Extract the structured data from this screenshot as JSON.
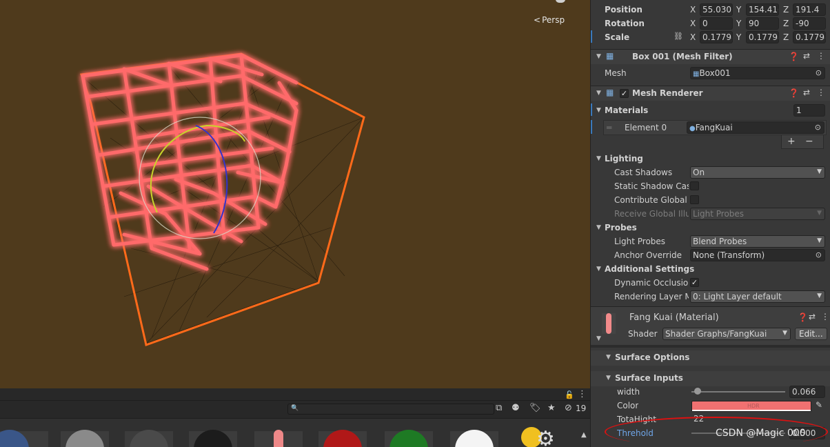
{
  "scene": {
    "camera_label": "Persp"
  },
  "project_bar": {
    "search_placeholder": "",
    "hidden_count": "19"
  },
  "inspector": {
    "transform": {
      "position_label": "Position",
      "rotation_label": "Rotation",
      "scale_label": "Scale",
      "position": {
        "x": "55.030",
        "y": "154.416",
        "z": "191.4"
      },
      "rotation": {
        "x": "0",
        "y": "90",
        "z": "-90"
      },
      "scale": {
        "x": "0.17798",
        "y": "0.17798",
        "z": "0.17798"
      }
    },
    "mesh_filter": {
      "title": "Box 001 (Mesh Filter)",
      "mesh_label": "Mesh",
      "mesh_value": "Box001"
    },
    "mesh_renderer": {
      "title": "Mesh Renderer",
      "materials_label": "Materials",
      "materials_count": "1",
      "element0_label": "Element 0",
      "element0_value": "FangKuai",
      "lighting_label": "Lighting",
      "cast_shadows_label": "Cast Shadows",
      "cast_shadows_value": "On",
      "static_shadow_label": "Static Shadow Cas",
      "contribute_gi_label": "Contribute Global Il",
      "receive_gi_label": "Receive Global Illu",
      "receive_gi_value": "Light Probes",
      "probes_label": "Probes",
      "light_probes_label": "Light Probes",
      "light_probes_value": "Blend Probes",
      "anchor_override_label": "Anchor Override",
      "anchor_override_value": "None (Transform)",
      "additional_settings_label": "Additional Settings",
      "dynamic_occlusion_label": "Dynamic Occlusio",
      "rendering_layer_label": "Rendering Layer M",
      "rendering_layer_value": "0: Light Layer default"
    },
    "material": {
      "title": "Fang Kuai (Material)",
      "shader_label": "Shader",
      "shader_value": "Shader Graphs/FangKuai",
      "edit_label": "Edit...",
      "surface_options_label": "Surface Options",
      "surface_inputs_label": "Surface Inputs",
      "width_label": "width",
      "width_value": "0.066",
      "width_fraction": 0.066,
      "color_label": "Color",
      "color_hex": "#f07171",
      "hdr_label": "HDR",
      "totahight_label": "TotaHight",
      "totahight_value": "22",
      "threhold_label": "Threhold",
      "threhold_value": "0.500"
    }
  },
  "watermark": "CSDN @Magic 000",
  "colors": {
    "scene_bg": "#4f3a1c",
    "wire_glow": "#ff4a3a",
    "outline_orange": "#ff6a1a",
    "annotation_red": "#dd1111"
  }
}
